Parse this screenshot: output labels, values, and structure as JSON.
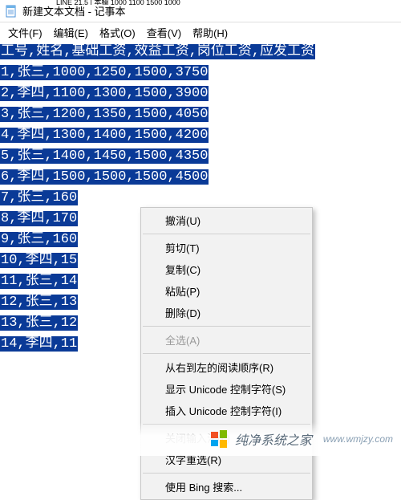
{
  "window": {
    "peek_text": "LINE 21,5 | 本欄 1000 1100 1500 1000",
    "title": "新建文本文档 - 记事本"
  },
  "menu": {
    "file": "文件(F)",
    "edit": "编辑(E)",
    "format": "格式(O)",
    "view": "查看(V)",
    "help": "帮助(H)"
  },
  "lines": [
    "工号,姓名,基础工资,效益工资,岗位工资,应发工资",
    "1,张三,1000,1250,1500,3750",
    "2,李四,1100,1300,1500,3900",
    "3,张三,1200,1350,1500,4050",
    "4,李四,1300,1400,1500,4200",
    "5,张三,1400,1450,1500,4350",
    "6,李四,1500,1500,1500,4500",
    "7,张三,160",
    "8,李四,170",
    "9,张三,160",
    "10,李四,15",
    "11,张三,14",
    "12,张三,13",
    "13,张三,12",
    "14,李四,11"
  ],
  "context_menu": {
    "undo": "撤消(U)",
    "cut": "剪切(T)",
    "copy": "复制(C)",
    "paste": "粘贴(P)",
    "delete": "删除(D)",
    "select_all": "全选(A)",
    "rtl": "从右到左的阅读顺序(R)",
    "show_unicode": "显示 Unicode 控制字符(S)",
    "insert_unicode": "插入 Unicode 控制字符(I)",
    "close_ime": "关闭输入法(L)",
    "hanzi_reconv": "汉字重选(R)",
    "bing_search": "使用 Bing 搜索..."
  },
  "watermark": {
    "brand": "纯净系统之家",
    "url": "www.wmjzy.com"
  }
}
